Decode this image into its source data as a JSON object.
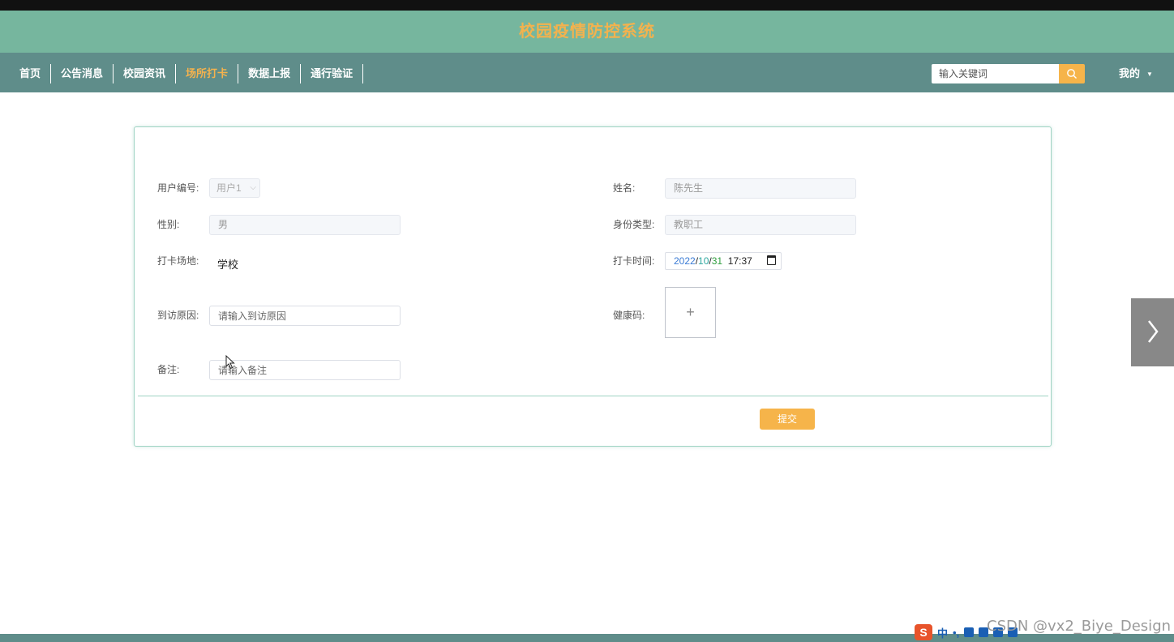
{
  "app_title": "校园疫情防控系统",
  "nav": {
    "items": [
      {
        "label": "首页",
        "active": false
      },
      {
        "label": "公告消息",
        "active": false
      },
      {
        "label": "校园资讯",
        "active": false
      },
      {
        "label": "场所打卡",
        "active": true
      },
      {
        "label": "数据上报",
        "active": false
      },
      {
        "label": "通行验证",
        "active": false
      }
    ],
    "search_placeholder": "输入关键词",
    "my_label": "我的"
  },
  "form": {
    "user_id": {
      "label": "用户编号:",
      "value": "用户1"
    },
    "name": {
      "label": "姓名:",
      "value": "陈先生"
    },
    "gender": {
      "label": "性别:",
      "value": "男"
    },
    "identity_type": {
      "label": "身份类型:",
      "value": "教职工"
    },
    "checkin_place": {
      "label": "打卡场地:",
      "value": "学校"
    },
    "checkin_time": {
      "label": "打卡时间:",
      "year": "2022",
      "month": "10",
      "day": "31",
      "time": "17:37"
    },
    "visit_reason": {
      "label": "到访原因:",
      "placeholder": "请输入到访原因"
    },
    "health_code": {
      "label": "健康码:",
      "upload_symbol": "+"
    },
    "remark": {
      "label": "备注:",
      "placeholder": "请输入备注"
    },
    "submit_label": "提交"
  },
  "watermark": "CSDN @vx2_Biye_Design",
  "ime": {
    "logo": "S",
    "mode": "中",
    "punct": "•,"
  },
  "colors": {
    "header_bg": "#76b69e",
    "nav_bg": "#5f8d8a",
    "accent": "#f6b44a"
  }
}
